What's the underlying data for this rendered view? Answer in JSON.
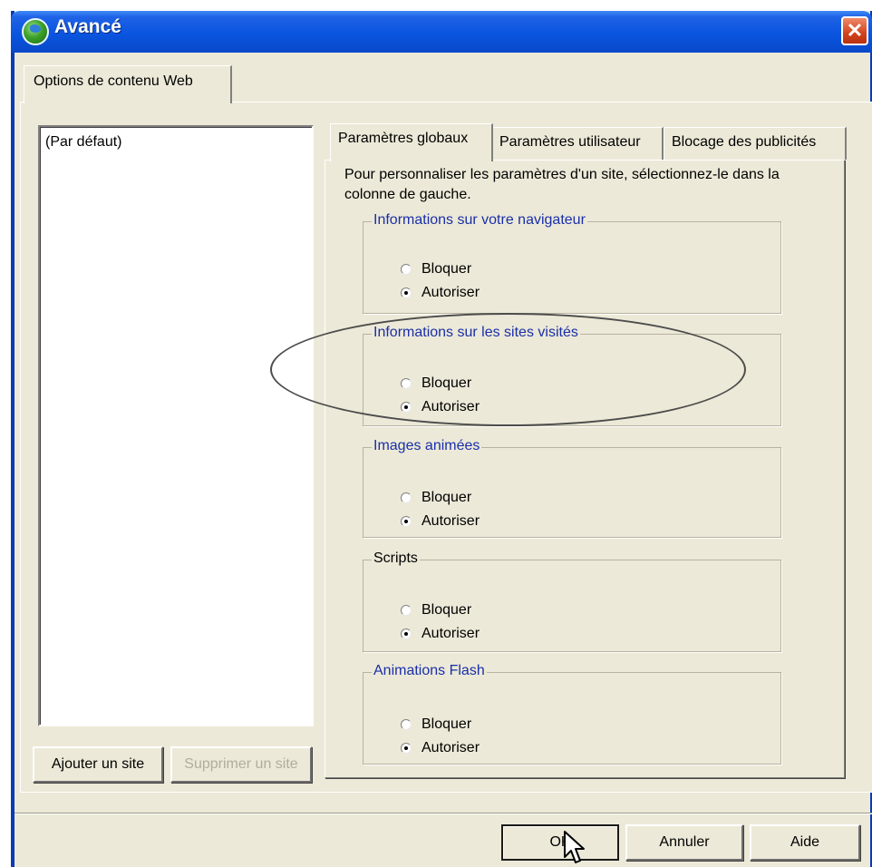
{
  "window": {
    "title": "Avancé"
  },
  "outer_tab": {
    "label": "Options de contenu Web"
  },
  "site_list": {
    "items": [
      "(Par défaut)"
    ]
  },
  "site_buttons": {
    "add": "Ajouter un site",
    "remove": "Supprimer un site"
  },
  "inner_tabs": [
    {
      "label": "Paramètres globaux",
      "active": true
    },
    {
      "label": "Paramètres utilisateur",
      "active": false
    },
    {
      "label": "Blocage des publicités",
      "active": false
    }
  ],
  "intro_text": "Pour personnaliser les paramètres d'un site, sélectionnez-le dans la colonne de gauche.",
  "groups": [
    {
      "label": "Informations sur votre navigateur",
      "label_color": "#1a2fa8",
      "options": [
        "Bloquer",
        "Autoriser"
      ],
      "selected": "Autoriser"
    },
    {
      "label": "Informations sur les sites visités",
      "label_color": "#1a2fa8",
      "options": [
        "Bloquer",
        "Autoriser"
      ],
      "selected": "Autoriser"
    },
    {
      "label": "Images animées",
      "label_color": "#1a2fa8",
      "options": [
        "Bloquer",
        "Autoriser"
      ],
      "selected": "Autoriser"
    },
    {
      "label": "Scripts",
      "label_color": "#000000",
      "options": [
        "Bloquer",
        "Autoriser"
      ],
      "selected": "Autoriser"
    },
    {
      "label": "Animations Flash",
      "label_color": "#1a2fa8",
      "options": [
        "Bloquer",
        "Autoriser"
      ],
      "selected": "Autoriser"
    }
  ],
  "dialog_buttons": {
    "ok": "OK",
    "cancel": "Annuler",
    "help": "Aide"
  },
  "colors": {
    "titlebar": "#0a55e0",
    "face": "#ece9d8",
    "close": "#d2431c"
  }
}
